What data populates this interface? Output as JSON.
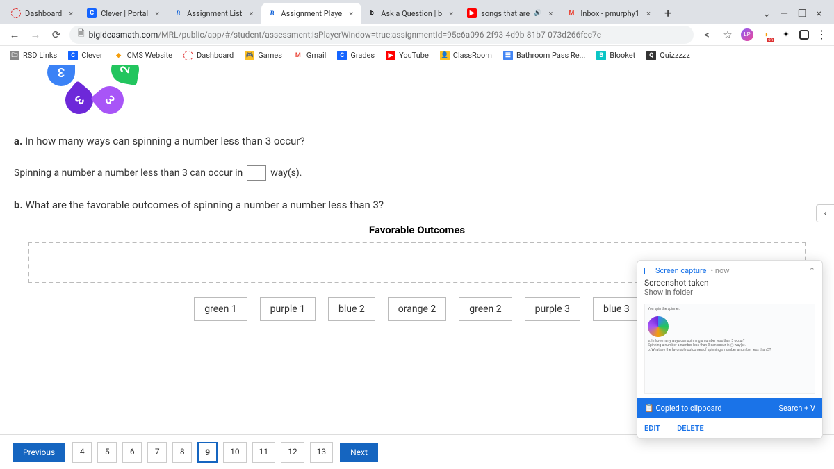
{
  "tabs": [
    {
      "title": "Dashboard"
    },
    {
      "title": "Clever | Portal"
    },
    {
      "title": "Assignment List"
    },
    {
      "title": "Assignment Playe"
    },
    {
      "title": "Ask a Question | b"
    },
    {
      "title": "songs that are"
    },
    {
      "title": "Inbox - pmurphy1"
    }
  ],
  "url": {
    "host": "bigideasmath.com",
    "path": "/MRL/public/app/#/student/assessment;isPlayerWindow=true;assignmentId=95c6a096-2f93-4d9b-81b7-073d266fec7e"
  },
  "bookmarks": [
    "RSD Links",
    "Clever",
    "CMS Website",
    "Dashboard",
    "Games",
    "Gmail",
    "Grades",
    "YouTube",
    "ClassRoom",
    "Bathroom Pass Re...",
    "Blooket",
    "Quizzzzz"
  ],
  "qa": {
    "label": "a.",
    "text": "In how many ways can spinning a number less than 3 occur?",
    "answer_prefix": "Spinning a number a number less than 3 can occur in",
    "answer_suffix": "way(s)."
  },
  "qb": {
    "label": "b.",
    "text": "What are the favorable outcomes of spinning a number a number less than 3?",
    "header": "Favorable Outcomes"
  },
  "tiles": [
    "green 1",
    "purple 1",
    "blue 2",
    "orange 2",
    "green 2",
    "purple 3",
    "blue 3"
  ],
  "pager": {
    "prev": "Previous",
    "next": "Next",
    "nums": [
      "4",
      "5",
      "6",
      "7",
      "8",
      "9",
      "10",
      "11",
      "12",
      "13"
    ],
    "active": "9"
  },
  "notif": {
    "app": "Screen capture",
    "time": "now",
    "title": "Screenshot taken",
    "sub": "Show in folder",
    "copied": "Copied to clipboard",
    "search": "Search + V",
    "edit": "EDIT",
    "delete": "DELETE"
  }
}
